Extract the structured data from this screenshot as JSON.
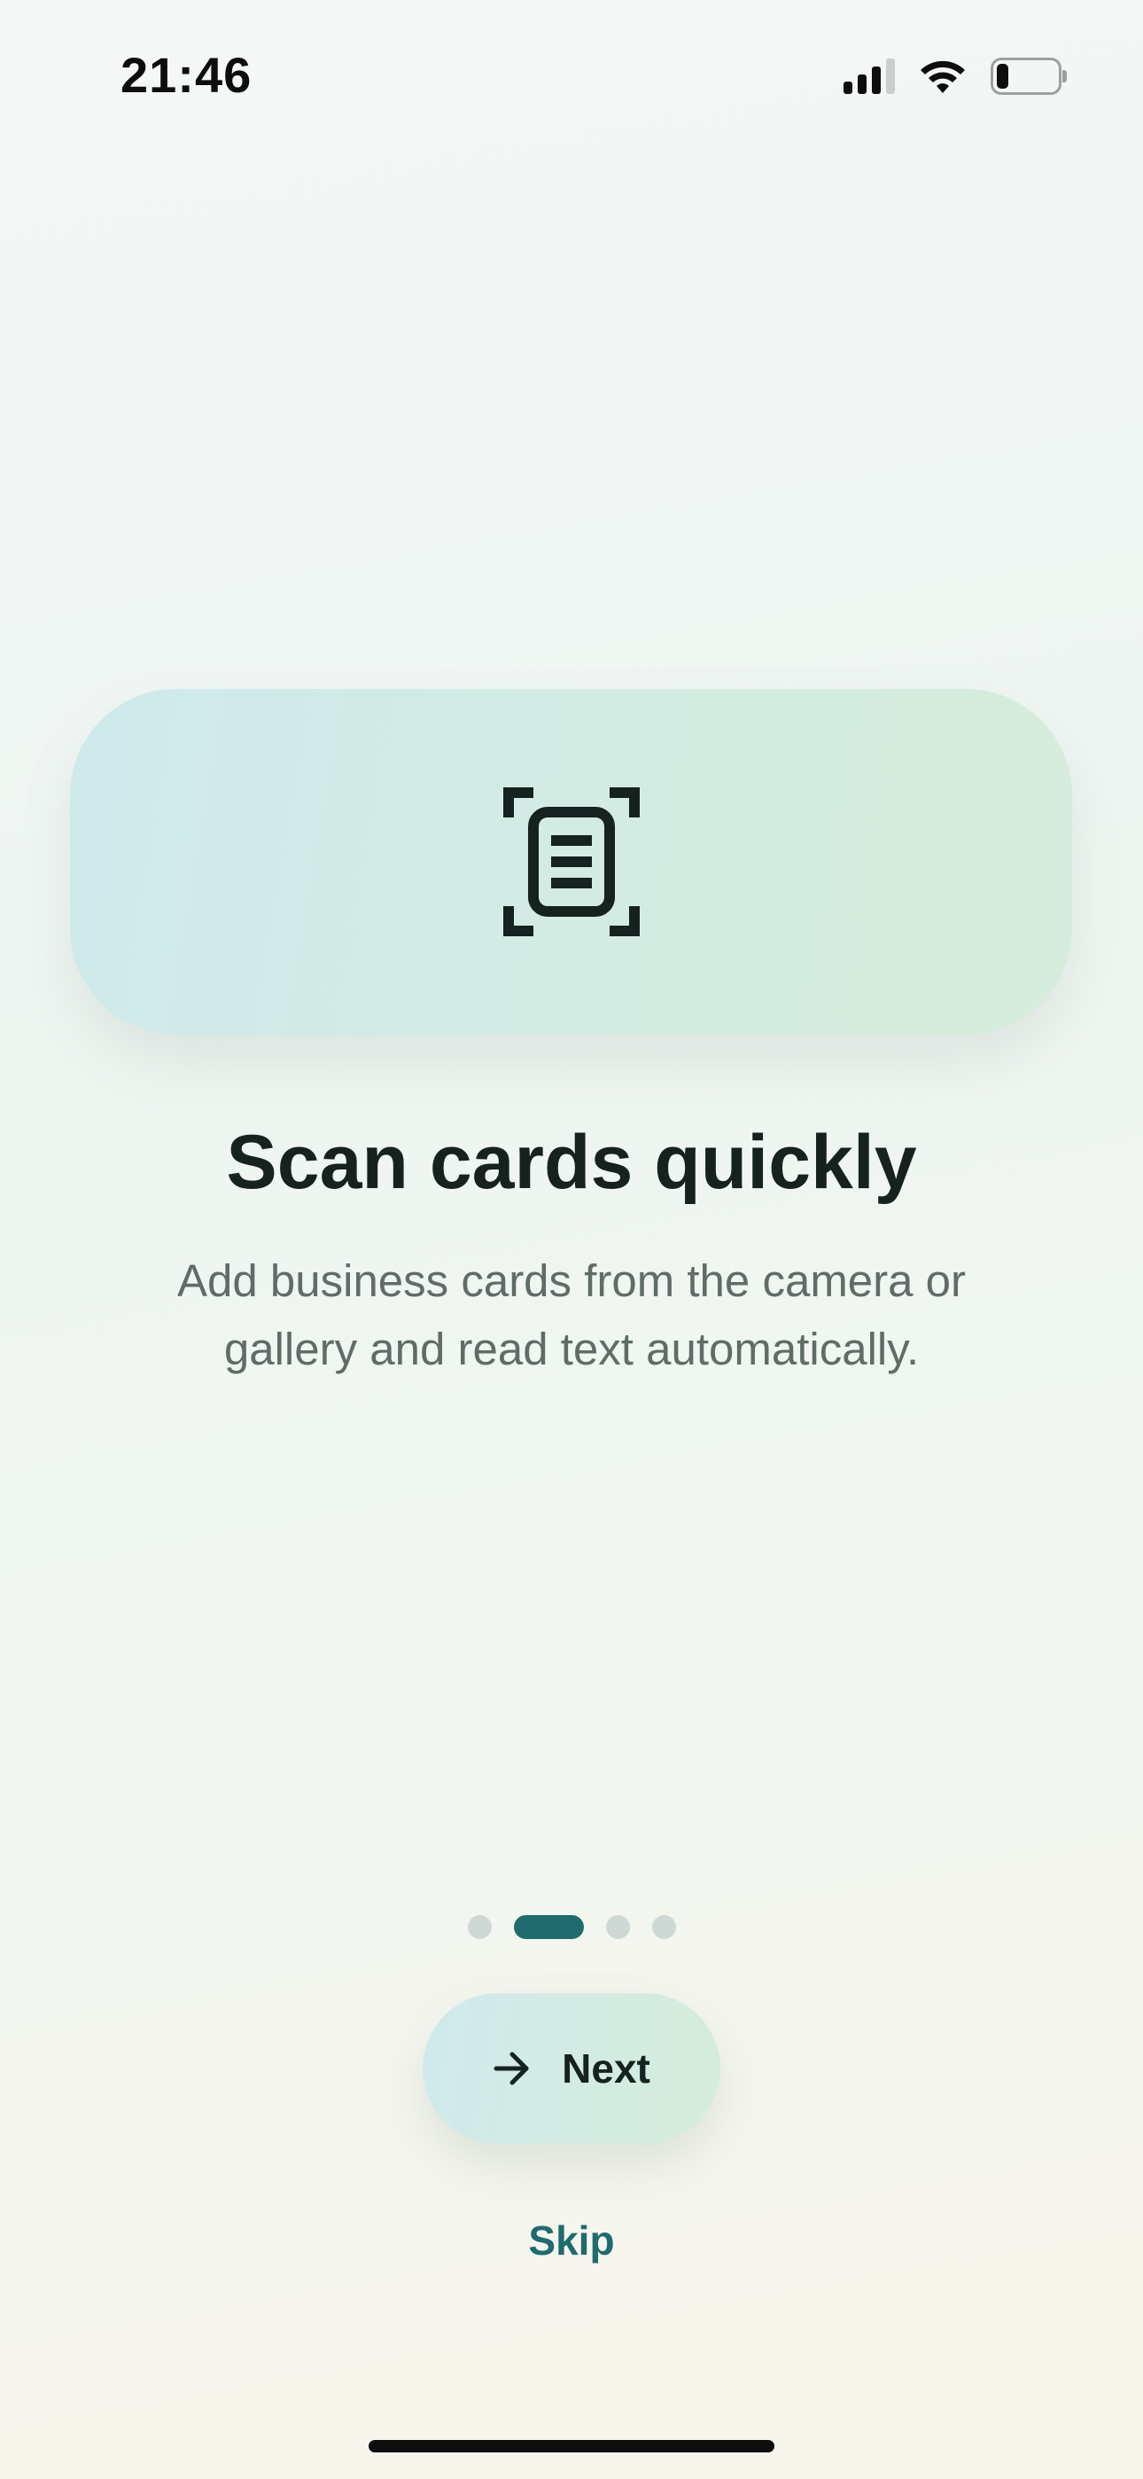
{
  "status_bar": {
    "time": "21:46",
    "icons": [
      "signal-icon",
      "wifi-icon",
      "battery-icon"
    ],
    "battery_level": 0.2
  },
  "hero": {
    "icon": "document-scan-icon",
    "title": "Scan cards quickly",
    "subtitle": "Add business cards from the camera or gallery and read text automatically."
  },
  "pagination": {
    "total": 4,
    "active_index": 1
  },
  "actions": {
    "next_label": "Next",
    "next_icon": "arrow-right-icon",
    "skip_label": "Skip"
  },
  "colors": {
    "accent": "#1f6b6e",
    "text_primary": "#15221f",
    "text_secondary": "#5f6c68",
    "card_gradient_start": "#d0eaec",
    "card_gradient_end": "#d6ecdb"
  }
}
